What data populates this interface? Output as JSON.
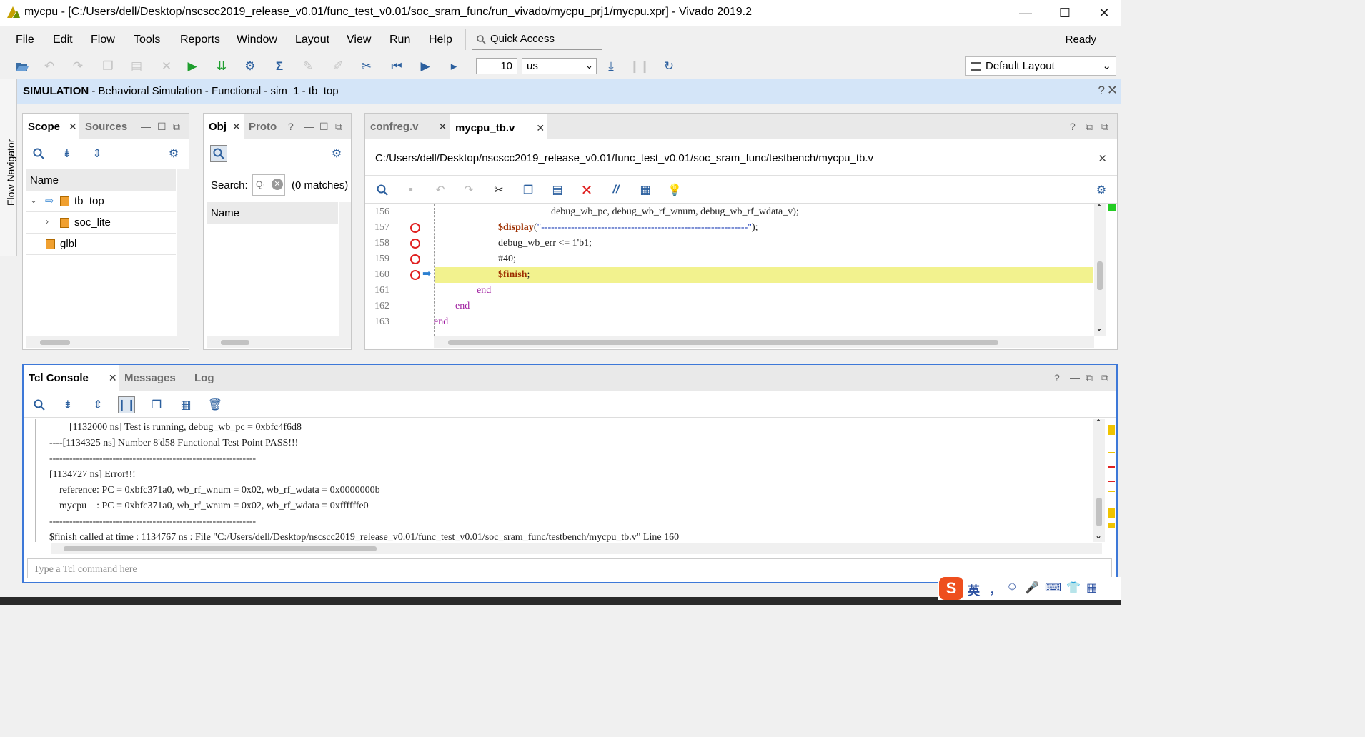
{
  "window": {
    "title": "mycpu - [C:/Users/dell/Desktop/nscscc2019_release_v0.01/func_test_v0.01/soc_sram_func/run_vivado/mycpu_prj1/mycpu.xpr] - Vivado 2019.2",
    "minimize": "—",
    "maximize": "☐",
    "close": "✕"
  },
  "menu": {
    "items": [
      "File",
      "Edit",
      "Flow",
      "Tools",
      "Reports",
      "Window",
      "Layout",
      "View",
      "Run",
      "Help"
    ],
    "quick_access": "Quick Access",
    "status": "Ready"
  },
  "toolbar": {
    "run_time": "10",
    "run_unit": "us",
    "layout": "Default Layout"
  },
  "flow_navigator": {
    "label": "Flow Navigator"
  },
  "simulation_header": {
    "bold": "SIMULATION",
    "rest": " - Behavioral Simulation - Functional - sim_1 - tb_top",
    "help": "?",
    "close": "✕"
  },
  "scope_panel": {
    "tabs": [
      "Scope",
      "Sources"
    ],
    "column": "Name",
    "rows": [
      {
        "label": "tb_top"
      },
      {
        "label": "soc_lite"
      },
      {
        "label": "glbl"
      }
    ]
  },
  "objects_panel": {
    "tabs": [
      "Obj",
      "Proto"
    ],
    "search_label": "Search:",
    "matches": "(0 matches)",
    "column": "Name"
  },
  "editor": {
    "tabs": [
      "confreg.v",
      "mycpu_tb.v"
    ],
    "path": "C:/Users/dell/Desktop/nscscc2019_release_v0.01/func_test_v0.01/soc_sram_func/testbench/mycpu_tb.v",
    "lines": [
      {
        "num": "156",
        "text": "debug_wb_pc, debug_wb_rf_wnum, debug_wb_rf_wdata_v);"
      },
      {
        "num": "157",
        "sys": "$display",
        "open": "(",
        "str": "\"--------------------------------------------------------------\"",
        "close": ");"
      },
      {
        "num": "158",
        "text": "debug_wb_err <= 1'b1;"
      },
      {
        "num": "159",
        "text": "#40;"
      },
      {
        "num": "160",
        "sys": "$finish",
        "close": ";"
      },
      {
        "num": "161",
        "kw": "end"
      },
      {
        "num": "162",
        "kw": "end"
      },
      {
        "num": "163",
        "kw": "end"
      }
    ]
  },
  "console": {
    "tabs": [
      "Tcl Console",
      "Messages",
      "Log"
    ],
    "lines": [
      "        [1132000 ns] Test is running, debug_wb_pc = 0xbfc4f6d8",
      "----[1134325 ns] Number 8'd58 Functional Test Point PASS!!!",
      "--------------------------------------------------------------",
      "[1134727 ns] Error!!!",
      "    reference: PC = 0xbfc371a0, wb_rf_wnum = 0x02, wb_rf_wdata = 0x0000000b",
      "    mycpu    : PC = 0xbfc371a0, wb_rf_wnum = 0x02, wb_rf_wdata = 0xffffffe0",
      "--------------------------------------------------------------",
      "$finish called at time : 1134767 ns : File \"C:/Users/dell/Desktop/nscscc2019_release_v0.01/func_test_v0.01/soc_sram_func/testbench/mycpu_tb.v\" Line 160"
    ],
    "input_placeholder": "Type a Tcl command here"
  },
  "ime": {
    "logo": "S",
    "lang": "英",
    "punct": "，"
  }
}
